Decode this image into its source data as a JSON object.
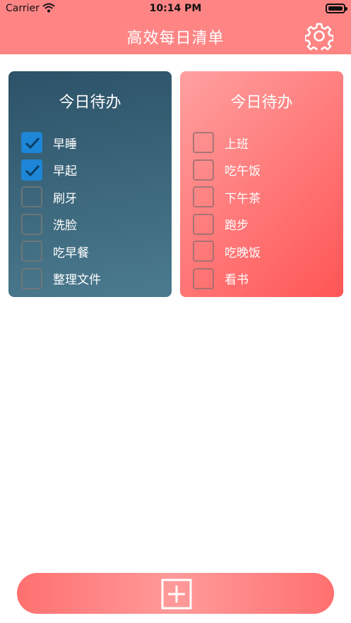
{
  "status_bar": {
    "carrier": "Carrier",
    "time": "10:14 PM"
  },
  "header": {
    "title": "高效每日清单",
    "settings_icon": "gear-icon"
  },
  "lists": [
    {
      "title": "今日待办",
      "items": [
        {
          "label": "早睡",
          "checked": true
        },
        {
          "label": "早起",
          "checked": true
        },
        {
          "label": "刷牙",
          "checked": false
        },
        {
          "label": "洗脸",
          "checked": false
        },
        {
          "label": "吃早餐",
          "checked": false
        },
        {
          "label": "整理文件",
          "checked": false
        }
      ]
    },
    {
      "title": "今日待办",
      "items": [
        {
          "label": "上班",
          "checked": false
        },
        {
          "label": "吃午饭",
          "checked": false
        },
        {
          "label": "下午茶",
          "checked": false
        },
        {
          "label": "跑步",
          "checked": false
        },
        {
          "label": "吃晚饭",
          "checked": false
        },
        {
          "label": "看书",
          "checked": false
        }
      ]
    }
  ],
  "add_button": {
    "icon": "plus-square-icon"
  },
  "colors": {
    "header": "#ff8585",
    "check": "#1e86d6",
    "left_card_top": "#2c5268",
    "right_card": "#ff7070"
  }
}
